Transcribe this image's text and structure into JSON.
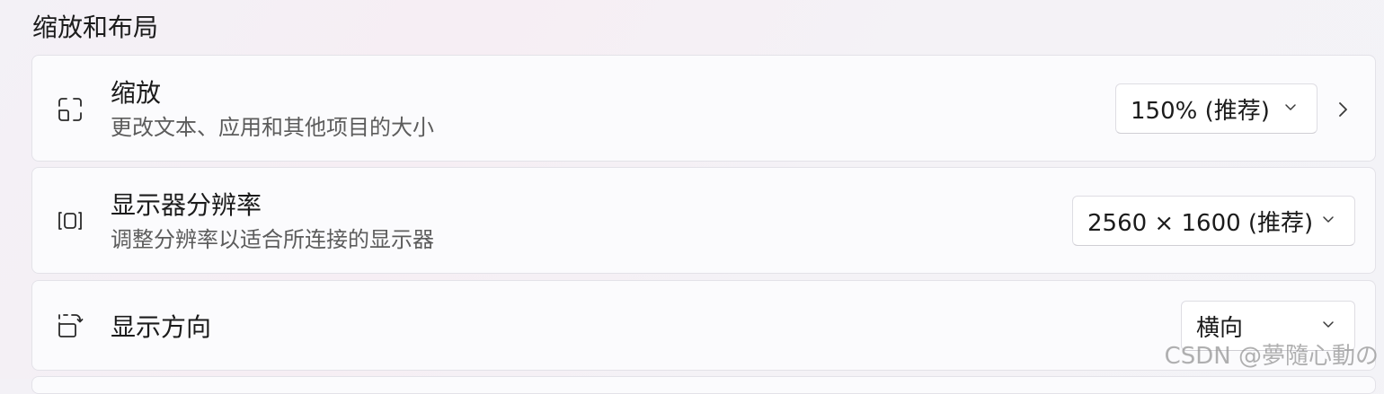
{
  "section": {
    "title": "缩放和布局"
  },
  "settings": [
    {
      "title": "缩放",
      "description": "更改文本、应用和其他项目的大小",
      "icon": "scale-icon",
      "dropdown_value": "150% (推荐)",
      "has_nav_arrow": true
    },
    {
      "title": "显示器分辨率",
      "description": "调整分辨率以适合所连接的显示器",
      "icon": "resolution-icon",
      "dropdown_value": "2560 × 1600 (推荐)",
      "has_nav_arrow": false
    },
    {
      "title": "显示方向",
      "description": "",
      "icon": "orientation-icon",
      "dropdown_value": "横向",
      "has_nav_arrow": false
    }
  ],
  "watermark": "CSDN @夢隨心動の",
  "colors": {
    "card_background": "#fbfbfd",
    "card_border": "#e3e2e8",
    "secondary_text": "#5c5c5c",
    "primary_text": "#1b1b1b"
  }
}
